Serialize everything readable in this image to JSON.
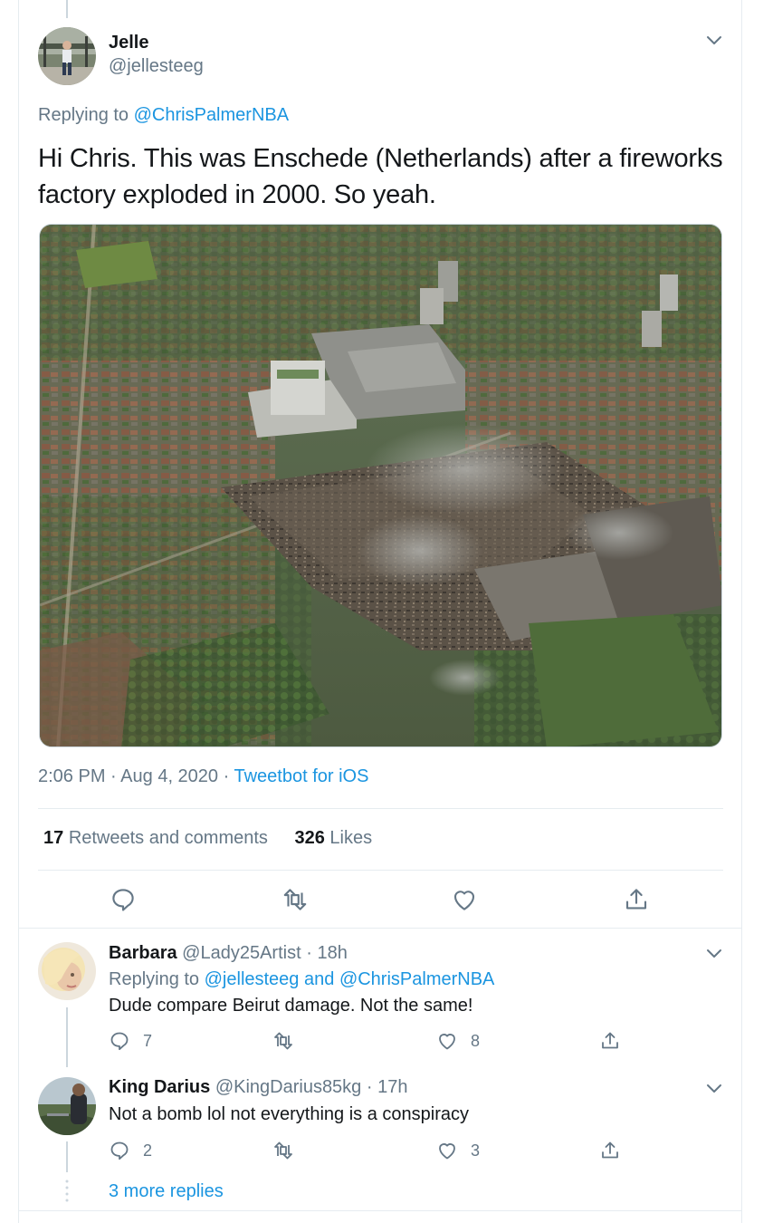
{
  "main_tweet": {
    "author_name": "Jelle",
    "author_handle": "@jellesteeg",
    "replying_to_prefix": "Replying to",
    "replying_to": "@ChrisPalmerNBA",
    "text": "Hi Chris. This was Enschede (Netherlands) after a fireworks factory exploded in 2000. So yeah.",
    "time": "2:06 PM",
    "date": "Aug 4, 2020",
    "source": "Tweetbot for iOS",
    "retweets_count": "17",
    "retweets_label": "Retweets and comments",
    "likes_count": "326",
    "likes_label": "Likes"
  },
  "replies": [
    {
      "name": "Barbara",
      "handle": "@Lady25Artist",
      "time": "18h",
      "replying_to_prefix": "Replying to",
      "replying_to_1": "@jellesteeg",
      "replying_to_and": "and",
      "replying_to_2": "@ChrisPalmerNBA",
      "text": "Dude compare Beirut damage. Not the same!",
      "reply_count": "7",
      "like_count": "8"
    },
    {
      "name": "King Darius",
      "handle": "@KingDarius85kg",
      "time": "17h",
      "text": "Not a bomb lol not everything is a conspiracy",
      "reply_count": "2",
      "like_count": "3"
    }
  ],
  "more_replies_label": "3 more replies",
  "separator": "·",
  "icons": [
    "chevron-down-icon",
    "reply-icon",
    "retweet-icon",
    "like-icon",
    "share-icon"
  ],
  "colors": {
    "link": "#1b95e0",
    "muted": "#657786",
    "text": "#14171a",
    "border": "#e6ecf0",
    "thread": "#ccd6dd"
  }
}
